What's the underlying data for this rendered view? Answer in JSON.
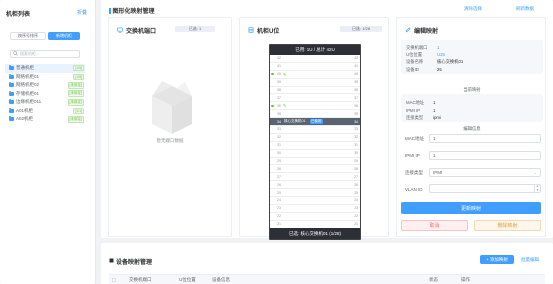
{
  "left": {
    "title": "机柜列表",
    "fold_label": "折叠",
    "btn_expand": "按序号排序",
    "btn_add": "新增机柜",
    "search_placeholder": "搜索机柜...",
    "tree": [
      {
        "label": "普通机柜",
        "tag": "[1/5]",
        "selected": true
      },
      {
        "label": "网络机柜01",
        "tag": "[1/5]"
      },
      {
        "label": "网络机柜02",
        "tag": "[未绑定]"
      },
      {
        "label": "存储机柜01",
        "tag": "[未绑定]"
      },
      {
        "label": "边缘机柜011",
        "tag": "[未绑定]"
      },
      {
        "label": "A01机柜",
        "tag": "[1/1]"
      },
      {
        "label": "A02机柜",
        "tag": "[未绑定]"
      }
    ]
  },
  "top": {
    "title": "图形化映射管理",
    "link_clear": "清除选择",
    "link_refresh": "刷新数据",
    "switch_card": {
      "title": "交换机端口",
      "badge": "已选: 1",
      "empty_text": "暂无端口数据"
    },
    "rack_card": {
      "title": "机柜U位",
      "badge": "已选: 1/28",
      "rack_header": "已用: 1U / 总计 42U",
      "rack_footer": "已选: 核心交换机01 (1/28)",
      "slots": [
        {
          "n": "42",
          "r": "42"
        },
        {
          "n": "41",
          "r": "41"
        },
        {
          "n": "40",
          "r": "40",
          "ok": true
        },
        {
          "n": "39",
          "r": "39"
        },
        {
          "n": "38",
          "r": "38"
        },
        {
          "n": "37",
          "r": "37"
        },
        {
          "n": "36",
          "r": "36",
          "ok": true
        },
        {
          "n": "35",
          "r": "35"
        },
        {
          "n": "34",
          "r": "34",
          "hl": true,
          "dev": "核心交换机01",
          "used": "已使用"
        },
        {
          "n": "33",
          "r": "33"
        },
        {
          "n": "32",
          "r": "32"
        },
        {
          "n": "31",
          "r": "31"
        },
        {
          "n": "30",
          "r": "30"
        },
        {
          "n": "29",
          "r": "29"
        },
        {
          "n": "28",
          "r": "28"
        },
        {
          "n": "27",
          "r": "27"
        },
        {
          "n": "26",
          "r": "26"
        },
        {
          "n": "25",
          "r": "25"
        },
        {
          "n": "24",
          "r": "24"
        },
        {
          "n": "23",
          "r": "23"
        },
        {
          "n": "22",
          "r": "22"
        },
        {
          "n": "21",
          "r": "21"
        }
      ]
    },
    "edit_card": {
      "title": "编辑映射",
      "info": [
        {
          "k": "交换机端口",
          "v": "1"
        },
        {
          "k": "U位位置",
          "v": "U25"
        },
        {
          "k": "设备名称",
          "v": "核心交换机01"
        },
        {
          "k": "设备ID",
          "v": "25"
        }
      ],
      "current_title": "当前映射",
      "current": [
        {
          "k": "MAC地址",
          "v": "1"
        },
        {
          "k": "IPMI IP",
          "v": "1"
        },
        {
          "k": "连接类型",
          "v": "ipmi"
        }
      ],
      "edit_title": "编辑信息",
      "mac_label": "MAC地址",
      "mac_value": "1",
      "ip_label": "IPMI IP",
      "ip_value": "1",
      "type_label": "连接类型",
      "type_value": "IPMI",
      "vlan_label": "VLAN ID",
      "vlan_value": "",
      "save_btn": "更新映射",
      "cancel_btn": "取消",
      "delete_btn": "删除映射"
    }
  },
  "bottom": {
    "title": "设备映射管理",
    "add_btn": "+ 添加映射",
    "batch_btn": "批量编辑",
    "cols": [
      "交换机端口",
      "U位位置",
      "设备信息",
      "状态",
      "操作"
    ]
  }
}
